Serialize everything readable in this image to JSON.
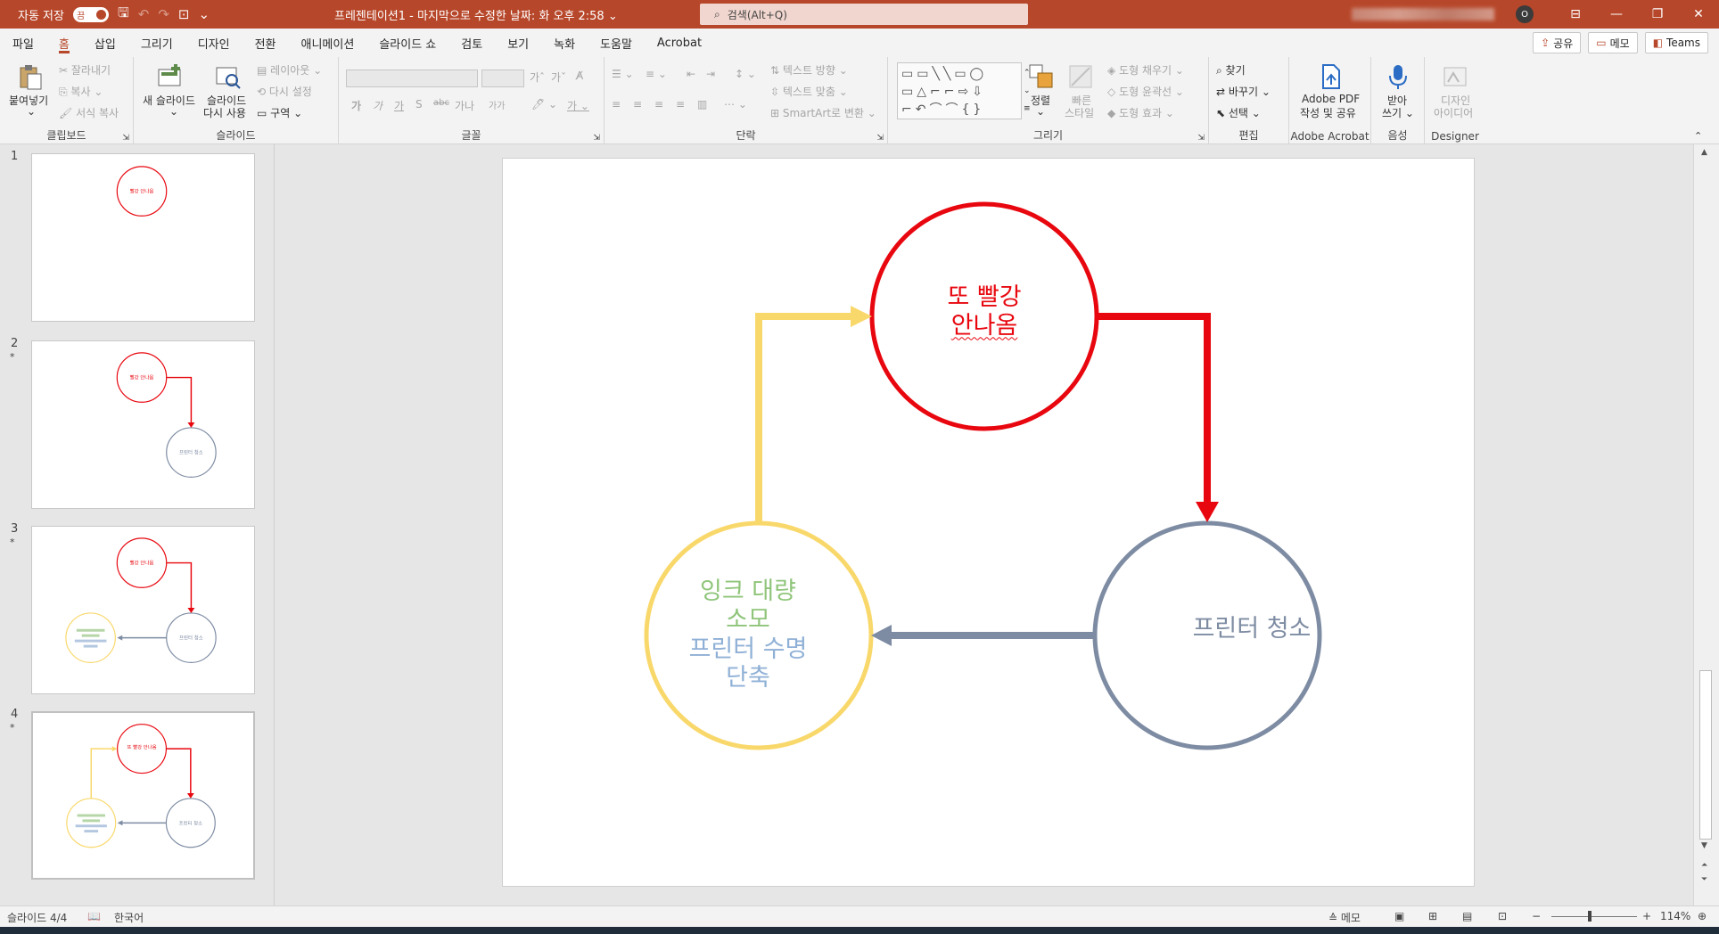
{
  "titlebar": {
    "autosave_label": "자동 저장",
    "autosave_state": "끔",
    "document_title": "프레젠테이션1 - 마지막으로 수정한 날짜: 화 오후 2:58 ⌄",
    "search_placeholder": "검색(Alt+Q)",
    "account_initial": "O",
    "accent_color": "#b7472a"
  },
  "menu": {
    "tabs": [
      "파일",
      "홈",
      "삽입",
      "그리기",
      "디자인",
      "전환",
      "애니메이션",
      "슬라이드 쇼",
      "검토",
      "보기",
      "녹화",
      "도움말",
      "Acrobat"
    ],
    "active_tab": "홈",
    "share_label": "공유",
    "memo_label": "메모",
    "teams_label": "Teams"
  },
  "ribbon": {
    "clipboard": {
      "paste": "붙여넣기",
      "cut": "잘라내기",
      "copy": "복사",
      "format_painter": "서식 복사",
      "label": "클립보드"
    },
    "slides": {
      "new_slide_1": "새 슬라이드",
      "reuse_1": "슬라이드",
      "reuse_2": "다시 사용",
      "layout": "레이아웃",
      "reset": "다시 설정",
      "section": "구역",
      "label": "슬라이드"
    },
    "font": {
      "label": "글꼴",
      "bold": "가",
      "italic": "가",
      "underline": "가",
      "shadow": "S",
      "strike": "abc",
      "spacing": "가나",
      "case": "가가"
    },
    "paragraph": {
      "text_direction": "텍스트 방향",
      "align_text": "텍스트 맞춤",
      "smartart": "SmartArt로 변환",
      "label": "단락"
    },
    "drawing": {
      "arrange_1": "정렬",
      "quick_styles_1": "빠른",
      "quick_styles_2": "스타일",
      "shape_fill": "도형 채우기",
      "shape_outline": "도형 윤곽선",
      "shape_effects": "도형 효과",
      "label": "그리기"
    },
    "editing": {
      "find": "찾기",
      "replace": "바꾸기",
      "select": "선택",
      "label": "편집"
    },
    "acrobat": {
      "line1": "Adobe PDF",
      "line2": "작성 및 공유",
      "label": "Adobe Acrobat"
    },
    "voice": {
      "line1": "받아",
      "line2": "쓰기",
      "label": "음성"
    },
    "designer": {
      "line1": "디자인",
      "line2": "아이디어",
      "label": "Designer"
    }
  },
  "thumbnails": [
    {
      "number": "1",
      "star": "",
      "top_text": "빨강 안나옴"
    },
    {
      "number": "2",
      "star": "*",
      "top_text": "빨강 안나옴",
      "right_text": "프린터 청소"
    },
    {
      "number": "3",
      "star": "*",
      "top_text": "빨강 안나옴",
      "right_text": "프린터 청소"
    },
    {
      "number": "4",
      "star": "*",
      "top_text": "또 빨강 안나옴",
      "right_text": "프린터 청소"
    }
  ],
  "slide": {
    "top_circle": {
      "line1": "또 빨강",
      "line2": "안나옴",
      "color": "#e8070f"
    },
    "left_circle": {
      "line1": "잉크 대량",
      "line2": "소모",
      "line3": "프린터 수명",
      "line4": "단축",
      "color": "#f9d86b",
      "green": "#8fc57a",
      "blue": "#8fb0d6"
    },
    "right_circle": {
      "text": "프린터 청소",
      "color": "#7e8ca3"
    }
  },
  "status": {
    "slide_counter": "슬라이드 4/4",
    "language": "한국어",
    "notes": "메모",
    "zoom": "114%"
  }
}
